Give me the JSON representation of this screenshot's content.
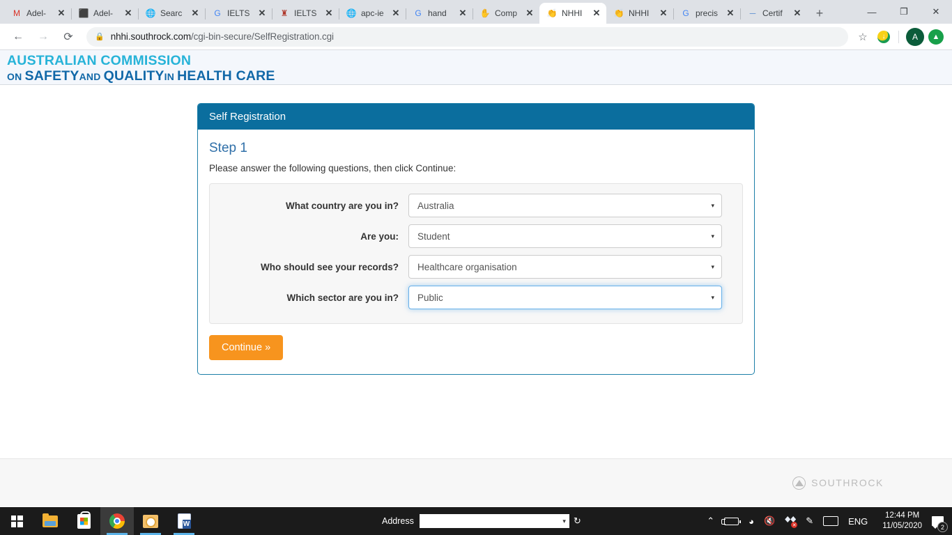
{
  "browser": {
    "tabs": [
      {
        "title": "Adel-",
        "icon": "gmail-icon",
        "glyph": "M",
        "color": "#d93025",
        "active": false
      },
      {
        "title": "Adel-",
        "icon": "sheets-icon",
        "glyph": "⬛",
        "color": "#0f9d58",
        "active": false
      },
      {
        "title": "Searc",
        "icon": "globe-icon",
        "glyph": "🌐",
        "color": "#5f6368",
        "active": false
      },
      {
        "title": "IELTS",
        "icon": "google-icon",
        "glyph": "G",
        "color": "#4285f4",
        "active": false
      },
      {
        "title": "IELTS",
        "icon": "crest-icon",
        "glyph": "♜",
        "color": "#b03a2e",
        "active": false
      },
      {
        "title": "apc-ie",
        "icon": "globe-icon",
        "glyph": "🌐",
        "color": "#5f6368",
        "active": false
      },
      {
        "title": "hand",
        "icon": "google-icon",
        "glyph": "G",
        "color": "#4285f4",
        "active": false
      },
      {
        "title": "Comp",
        "icon": "hands-icon",
        "glyph": "✋",
        "color": "#3b7dd8",
        "active": false
      },
      {
        "title": "NHHI",
        "icon": "handwash-icon",
        "glyph": "👏",
        "color": "#f0832a",
        "active": true
      },
      {
        "title": "NHHI",
        "icon": "handwash-icon",
        "glyph": "👏",
        "color": "#f0832a",
        "active": false
      },
      {
        "title": "precis",
        "icon": "google-icon",
        "glyph": "G",
        "color": "#4285f4",
        "active": false
      },
      {
        "title": "Certif",
        "icon": "doc-icon",
        "glyph": "─",
        "color": "#5b8fd0",
        "active": false
      }
    ],
    "new_tab_label": "+",
    "window_controls": {
      "minimize": "—",
      "maximize": "❐",
      "close": "✕"
    },
    "toolbar": {
      "back": "←",
      "forward": "→",
      "reload": "⟳",
      "lock_icon": "🔒",
      "url_host": "nhhi.southrock.com",
      "url_path": "/cgi-bin-secure/SelfRegistration.cgi",
      "bookmark_star": "☆",
      "profile_initial": "A"
    }
  },
  "site": {
    "logo": {
      "line1": "AUSTRALIAN COMMISSION",
      "line2_parts": [
        "ON ",
        "SAFETY",
        "AND ",
        "QUALITY",
        "IN ",
        "HEALTH CARE"
      ]
    },
    "footer": {
      "brand": "SOUTHROCK"
    }
  },
  "form": {
    "card_title": "Self Registration",
    "step_title": "Step 1",
    "lede": "Please answer the following questions, then click Continue:",
    "fields": [
      {
        "label": "What country are you in?",
        "value": "Australia",
        "focused": false
      },
      {
        "label": "Are you:",
        "value": "Student",
        "focused": false
      },
      {
        "label": "Who should see your records?",
        "value": "Healthcare organisation",
        "focused": false
      },
      {
        "label": "Which sector are you in?",
        "value": "Public",
        "focused": true
      }
    ],
    "caret": "▾",
    "continue_label": "Continue »"
  },
  "taskbar": {
    "address_label": "Address",
    "address_value": "",
    "language": "ENG",
    "time": "12:44 PM",
    "date": "11/05/2020",
    "notification_count": "2",
    "tray": {
      "overflow": "⌃",
      "mute_glyph": "🔇",
      "pen_glyph": "✎"
    }
  }
}
